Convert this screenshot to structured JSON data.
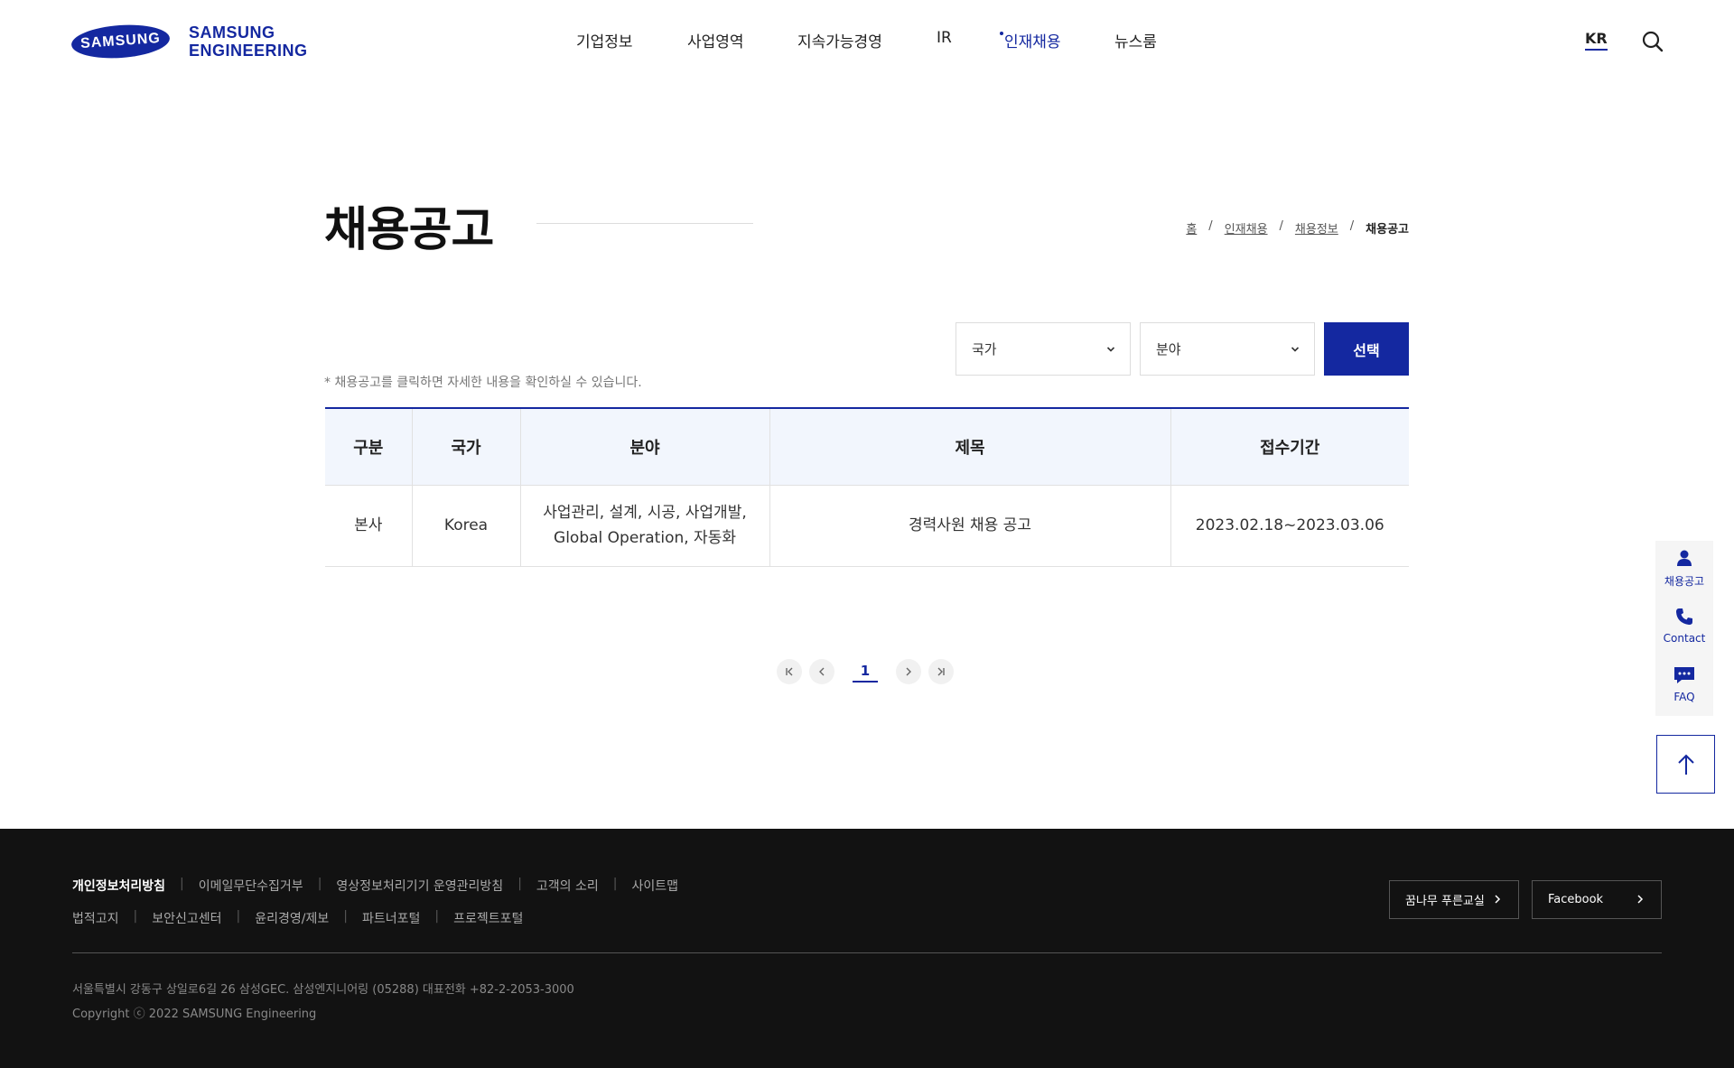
{
  "header": {
    "logo_mark": "SAMSUNG",
    "logo_line1": "SAMSUNG",
    "logo_line2": "ENGINEERING",
    "nav": [
      "기업정보",
      "사업영역",
      "지속가능경영",
      "IR",
      "인재채용",
      "뉴스룸"
    ],
    "active_nav": "인재채용",
    "lang": "KR"
  },
  "page": {
    "title": "채용공고",
    "breadcrumb": [
      "홈",
      "인재채용",
      "채용정보",
      "채용공고"
    ]
  },
  "filters": {
    "note": "* 채용공고를 클릭하면 자세한 내용을 확인하실 수 있습니다.",
    "country": "국가",
    "field": "분야",
    "submit": "선택"
  },
  "table": {
    "headers": [
      "구분",
      "국가",
      "분야",
      "제목",
      "접수기간"
    ],
    "rows": [
      {
        "category": "본사",
        "country": "Korea",
        "field_line1": "사업관리, 설계, 시공, 사업개발,",
        "field_line2": "Global Operation, 자동화",
        "title": "경력사원 채용 공고",
        "period": "2023.02.18~2023.03.06"
      }
    ]
  },
  "pagination": {
    "current": "1"
  },
  "quick_menu": {
    "items": [
      "채용공고",
      "Contact",
      "FAQ"
    ],
    "accent": "#1428a0"
  },
  "footer": {
    "links_row1": [
      "개인정보처리방침",
      "이메일무단수집거부",
      "영상정보처리기기 운영관리방침",
      "고객의 소리",
      "사이트맵"
    ],
    "links_row2": [
      "법적고지",
      "보안신고센터",
      "윤리경영/제보",
      "파트너포털",
      "프로젝트포털"
    ],
    "btn1": "꿈나무 푸른교실",
    "btn2": "Facebook",
    "address": "서울특별시 강동구 상일로6길 26 삼성GEC. 삼성엔지니어링 (05288) 대표전화 +82-2-2053-3000",
    "copyright": "Copyright ⓒ 2022 SAMSUNG Engineering"
  }
}
